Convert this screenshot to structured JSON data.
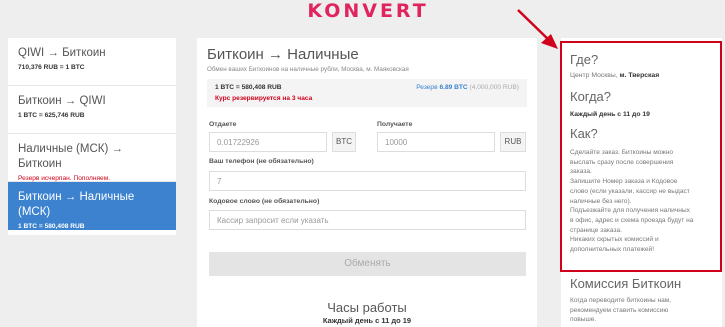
{
  "brand": {
    "logo_text": "KONVERT",
    "logo_color": "#e0245e"
  },
  "pairs": [
    {
      "title": "QIWI → Биткоин",
      "rate": "710,376 RUB = 1 BTC"
    },
    {
      "title": "Биткоин → QIWI",
      "rate": "1 BTC = 625,746 RUB"
    },
    {
      "title": "Наличные (МСК) → Биткоин",
      "warning": "Резерв исчерпан. Пополняем."
    },
    {
      "title": "Биткоин → Наличные (МСК)",
      "rate": "1 BTC = 580,408 RUB",
      "active": true
    }
  ],
  "form": {
    "title": "Биткоин → Наличные",
    "subtitle": "Обмен ваших Биткоинов на наличные рубли, Москва, м. Маяковская",
    "rate": "1 BTC = 580,408 RUB",
    "reserved_note": "Курс резервируется на 3 часа",
    "reserve_label": "Резерв",
    "reserve_value": "6.89 BTC",
    "reserve_rub": "(4,000,000 RUB)",
    "give_label": "Отдаете",
    "give_value": "0.01722926",
    "give_unit": "BTC",
    "get_label": "Получаете",
    "get_value": "10000",
    "get_unit": "RUB",
    "phone_label": "Ваш телефон (не обязательно)",
    "phone_value": "7",
    "code_label": "Кодовое слово (не обязательно)",
    "code_placeholder": "Кассир запросит если указать",
    "submit_label": "Обменять",
    "hours_title": "Часы работы",
    "hours_value": "Каждый день с 11 до 19"
  },
  "info": {
    "where_title": "Где?",
    "where_text": "Центр Москвы,",
    "where_metro": "м. Тверская",
    "when_title": "Когда?",
    "when_text": "Каждый день с 11 до 19",
    "how_title": "Как?",
    "how_lines": [
      "Сделайте заказ. Биткоины можно",
      "выслать сразу после совершения",
      "заказа.",
      "Запишите Номер заказа и Кодовое",
      "слово (если указали, кассир не выдаст",
      "наличные без него).",
      "Подъезжайте для получения наличных",
      "в офис, адрес и схема проезда будут на",
      "странице заказа.",
      "Никаких скрытых комиссий и",
      "дополнительных платежей!"
    ],
    "commission_title": "Комиссия Биткоин",
    "commission_lines": [
      "Когда переводите биткоины нам,",
      "рекомендуем ставить комиссию",
      "повыше."
    ]
  },
  "colors": {
    "active": "#3c82cf",
    "highlight": "#d0021b",
    "background": "#eeeeee"
  }
}
